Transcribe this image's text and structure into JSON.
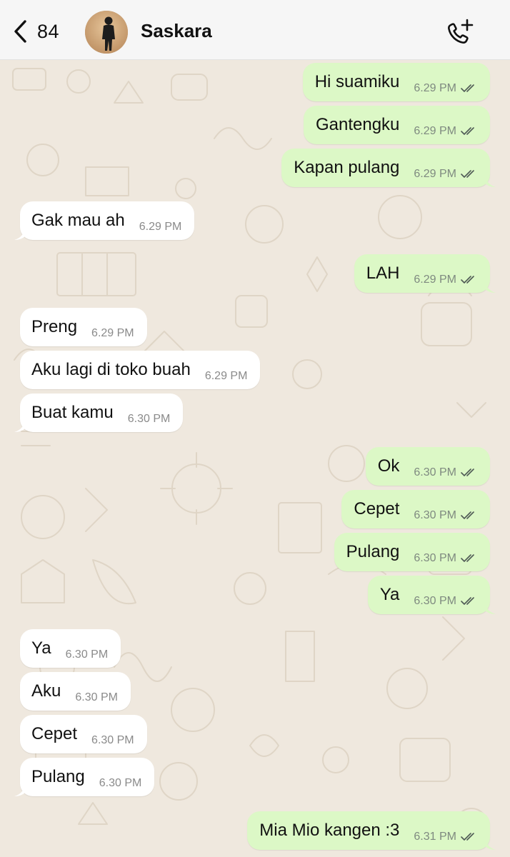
{
  "header": {
    "back_count": "84",
    "contact_name": "Saskara",
    "back_icon": "chevron-left-icon",
    "call_icon": "phone-add-icon"
  },
  "colors": {
    "chat_background": "#efe8de",
    "incoming_bubble": "#ffffff",
    "outgoing_bubble": "#dcf8c6",
    "read_ticks": "#4f5a55"
  },
  "messages": [
    {
      "direction": "outgoing",
      "text": "Hi suamiku",
      "time": "6.29 PM",
      "status": "read"
    },
    {
      "direction": "outgoing",
      "text": "Gantengku",
      "time": "6.29 PM",
      "status": "read"
    },
    {
      "direction": "outgoing",
      "text": "Kapan pulang",
      "time": "6.29 PM",
      "status": "read"
    },
    {
      "direction": "incoming",
      "text": "Gak mau ah",
      "time": "6.29 PM"
    },
    {
      "direction": "outgoing",
      "text": "LAH",
      "time": "6.29 PM",
      "status": "read"
    },
    {
      "direction": "incoming",
      "text": "Preng",
      "time": "6.29 PM"
    },
    {
      "direction": "incoming",
      "text": "Aku lagi di toko buah",
      "time": "6.29 PM"
    },
    {
      "direction": "incoming",
      "text": "Buat kamu",
      "time": "6.30 PM"
    },
    {
      "direction": "outgoing",
      "text": "Ok",
      "time": "6.30 PM",
      "status": "read"
    },
    {
      "direction": "outgoing",
      "text": "Cepet",
      "time": "6.30 PM",
      "status": "read"
    },
    {
      "direction": "outgoing",
      "text": "Pulang",
      "time": "6.30 PM",
      "status": "read"
    },
    {
      "direction": "outgoing",
      "text": "Ya",
      "time": "6.30 PM",
      "status": "read"
    },
    {
      "direction": "incoming",
      "text": "Ya",
      "time": "6.30 PM"
    },
    {
      "direction": "incoming",
      "text": "Aku",
      "time": "6.30 PM"
    },
    {
      "direction": "incoming",
      "text": "Cepet",
      "time": "6.30 PM"
    },
    {
      "direction": "incoming",
      "text": "Pulang",
      "time": "6.30 PM"
    },
    {
      "direction": "outgoing",
      "text": "Mia Mio kangen :3",
      "time": "6.31 PM",
      "status": "read"
    }
  ]
}
